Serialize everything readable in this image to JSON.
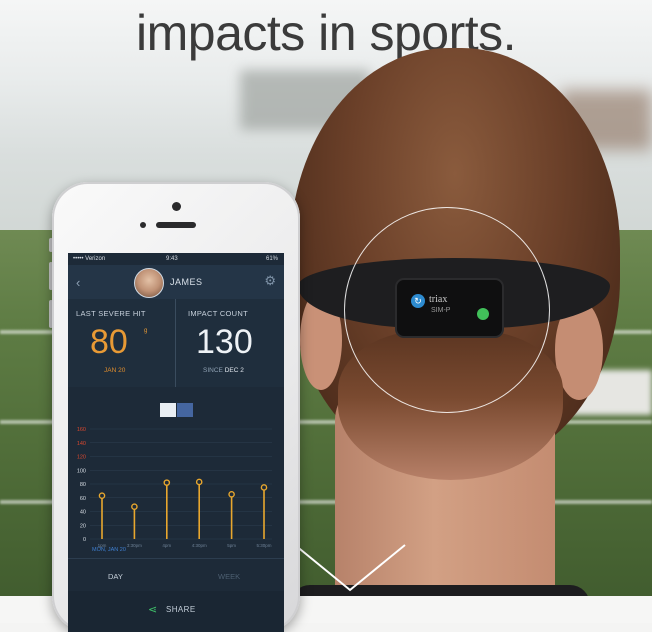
{
  "headline": "impacts in sports.",
  "sensor": {
    "brand": "triax",
    "model": "SIM-P"
  },
  "phone": {
    "status": {
      "carrier": "••••• Verizon",
      "time": "9:43",
      "battery": "61%"
    },
    "header": {
      "name": "JAMES"
    },
    "stats": {
      "last_severe_label": "LAST SEVERE HIT",
      "last_severe_value": "80",
      "last_severe_unit": "g",
      "last_severe_date": "JAN 20",
      "impact_count_label": "IMPACT COUNT",
      "impact_count_value": "130",
      "impact_since_prefix": "SINCE",
      "impact_since_date": "DEC 2"
    },
    "weekday_label": "MON, JAN 20",
    "tabs": {
      "day": "DAY",
      "week": "WEEK"
    },
    "share_label": "SHARE"
  },
  "chart_data": {
    "type": "scatter",
    "y_ticks": [
      0,
      20,
      40,
      60,
      80,
      100,
      120,
      140,
      160
    ],
    "ylim": [
      0,
      160
    ],
    "x": [
      "1pm",
      "3:30pm",
      "4pm",
      "4:30pm",
      "5pm",
      "5:30pm"
    ],
    "values": [
      63,
      47,
      82,
      83,
      65,
      75
    ],
    "colors": {
      "stem": "#e8a72e",
      "axis_high": "#d9482f",
      "axis_low": "#d7dde4"
    }
  }
}
